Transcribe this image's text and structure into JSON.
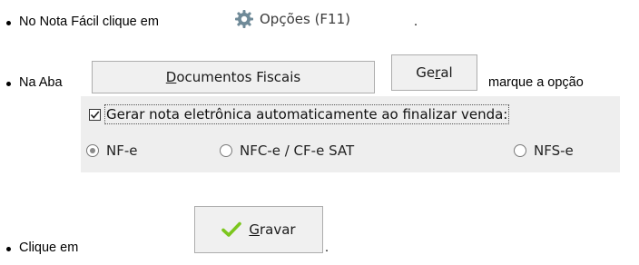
{
  "steps": [
    {
      "text_before": "No Nota Fácil clique em",
      "text_after": "."
    },
    {
      "text_before": "Na Aba",
      "text_after": "marque a opção"
    },
    {
      "text_before": "Clique em",
      "text_after": "."
    }
  ],
  "opcoes_button": {
    "icon": "gear-icon",
    "label": "Opções (F11)"
  },
  "tabs": [
    {
      "mnemonic": "D",
      "rest": "ocumentos Fiscais"
    },
    {
      "pre": "Ge",
      "mnemonic": "r",
      "post": "al"
    }
  ],
  "auto_nfe_checkbox": {
    "label": "Gerar nota eletrônica automaticamente ao finalizar venda:",
    "checked": true
  },
  "radio_options": [
    {
      "label": "NF-e",
      "selected": true
    },
    {
      "label": "NFC-e / CF-e SAT",
      "selected": false
    },
    {
      "label": "NFS-e",
      "selected": false
    }
  ],
  "gravar_button": {
    "icon": "checkmark-icon",
    "mnemonic": "G",
    "rest": "ravar",
    "icon_color": "#7cc61e"
  }
}
